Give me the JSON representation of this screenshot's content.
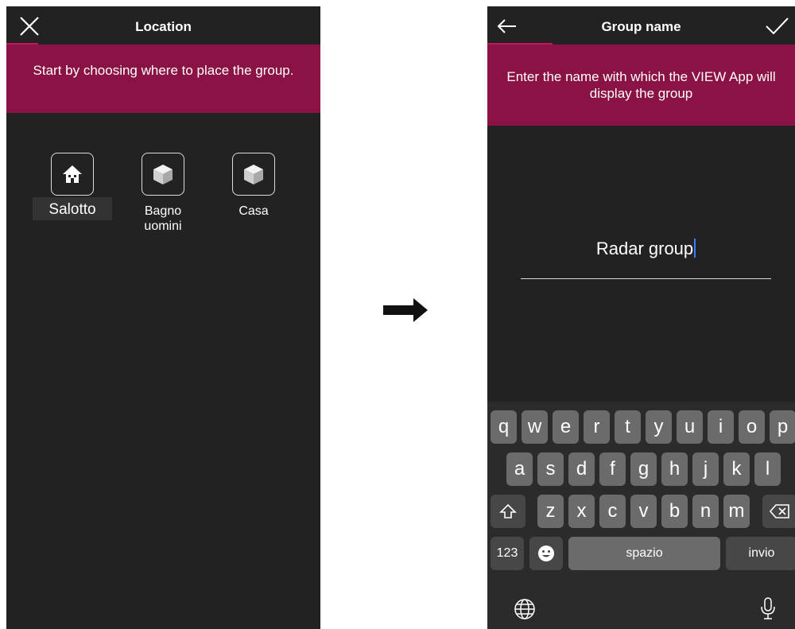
{
  "left_screen": {
    "title": "Location",
    "instruction": "Start by choosing where to place the group.",
    "locations": [
      {
        "label": "Salotto",
        "icon": "house-icon",
        "selected": true
      },
      {
        "label": "Bagno\nuomini",
        "icon": "cube-icon",
        "selected": false
      },
      {
        "label": "Casa",
        "icon": "cube-icon",
        "selected": false
      }
    ]
  },
  "right_screen": {
    "title": "Group name",
    "instruction": "Enter the name with which the VIEW App will display the group",
    "name_field_value": "Radar group",
    "keyboard": {
      "row1": [
        "q",
        "w",
        "e",
        "r",
        "t",
        "y",
        "u",
        "i",
        "o",
        "p"
      ],
      "row2": [
        "a",
        "s",
        "d",
        "f",
        "g",
        "h",
        "j",
        "k",
        "l"
      ],
      "row3": [
        "z",
        "x",
        "c",
        "v",
        "b",
        "n",
        "m"
      ],
      "numbers_key": "123",
      "space_key": "spazio",
      "return_key": "invio"
    }
  },
  "colors": {
    "accent": "#8a1244",
    "background": "#222222",
    "tab_underline": "#c2185b"
  }
}
